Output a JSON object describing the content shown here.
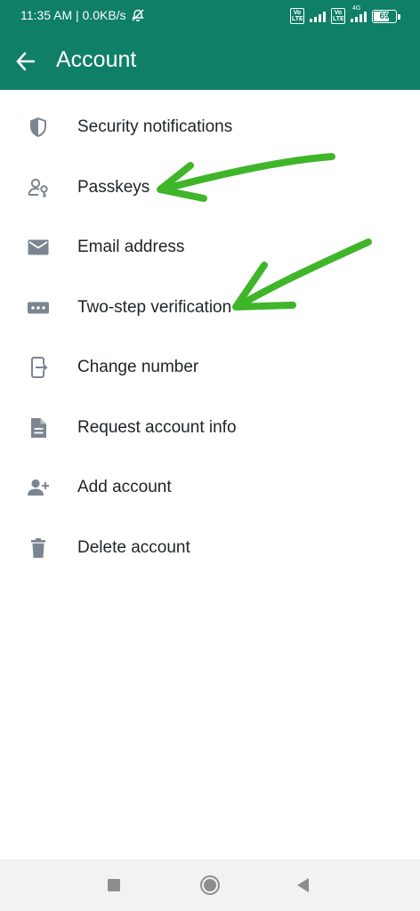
{
  "status_bar": {
    "time_speed": "11:35 AM | 0.0KB/s",
    "sim1_badge": "Vo LTE",
    "sim2_badge": "Vo LTE",
    "network_type": "4G",
    "battery_level": "69",
    "icons": [
      "alarm-off-icon",
      "signal-icon",
      "battery-icon"
    ]
  },
  "header": {
    "title": "Account",
    "back_icon": "arrow-back-icon",
    "background_color": "#0f7f67"
  },
  "menu": {
    "items": [
      {
        "label": "Security notifications",
        "icon": "shield-icon"
      },
      {
        "label": "Passkeys",
        "icon": "person-key-icon"
      },
      {
        "label": "Email address",
        "icon": "envelope-icon"
      },
      {
        "label": "Two-step verification",
        "icon": "password-dots-icon"
      },
      {
        "label": "Change number",
        "icon": "change-number-icon"
      },
      {
        "label": "Request account info",
        "icon": "document-icon"
      },
      {
        "label": "Add account",
        "icon": "person-add-icon"
      },
      {
        "label": "Delete account",
        "icon": "trash-icon"
      }
    ],
    "icon_color": "#7b8590"
  },
  "annotations": {
    "arrow_color": "#3fb52a",
    "targets": [
      "Passkeys",
      "Two-step verification"
    ]
  },
  "nav_bar": {
    "buttons": [
      "recents-square-icon",
      "home-circle-icon",
      "back-triangle-icon"
    ]
  }
}
